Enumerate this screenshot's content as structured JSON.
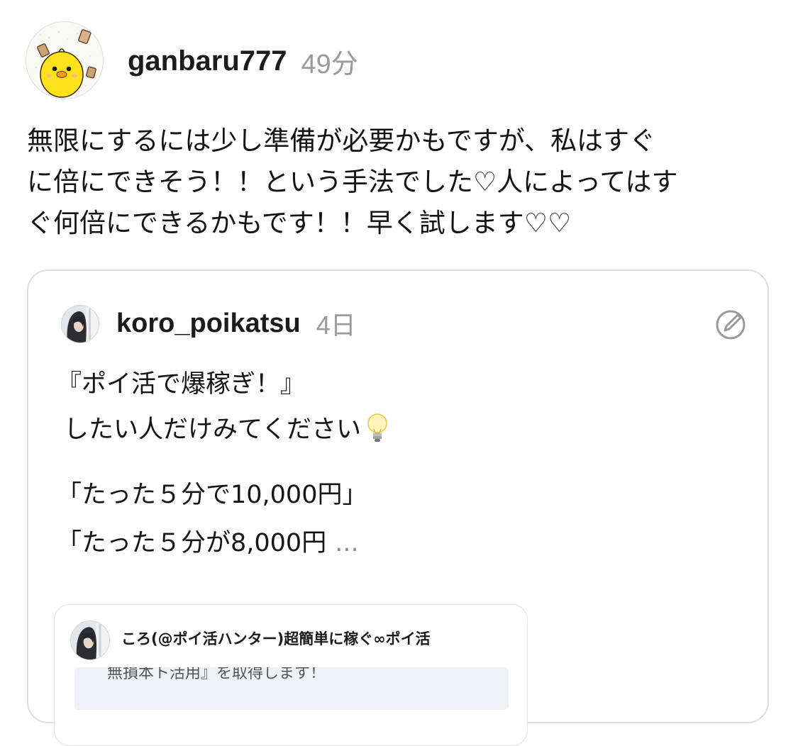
{
  "post": {
    "author": "ganbaru777",
    "time": "49分",
    "body_lines": [
      "無限にするには少し準備が必要かもですが、私はすぐ",
      "に倍にできそう！！という手法でした♡人によってはす",
      "ぐ何倍にできるかもです！！早く試します♡♡"
    ]
  },
  "quote": {
    "author": "koro_poikatsu",
    "time": "4日",
    "lines": [
      "『ポイ活で爆稼ぎ！』",
      "したい人だけみてください",
      "「たった５分で10,000円」",
      "「たった５分が8,000円"
    ],
    "ellipsis": "..."
  },
  "embed": {
    "title": "ころ(@ポイ活ハンター)超簡単に稼ぐ∞ポイ活",
    "preview_text": "無損本ト活用』を取得します！"
  },
  "icons": {
    "main_avatar": "chick-avatar-icon",
    "quote_avatar": "user-photo-avatar-icon",
    "embed_avatar": "user-photo-avatar-icon",
    "edit": "pen-circle-icon",
    "bulb": "light-bulb-icon"
  },
  "colors": {
    "muted_text": "#9a9a9a",
    "card_border": "#dedede",
    "embed_preview_bg": "#eef2f6"
  }
}
